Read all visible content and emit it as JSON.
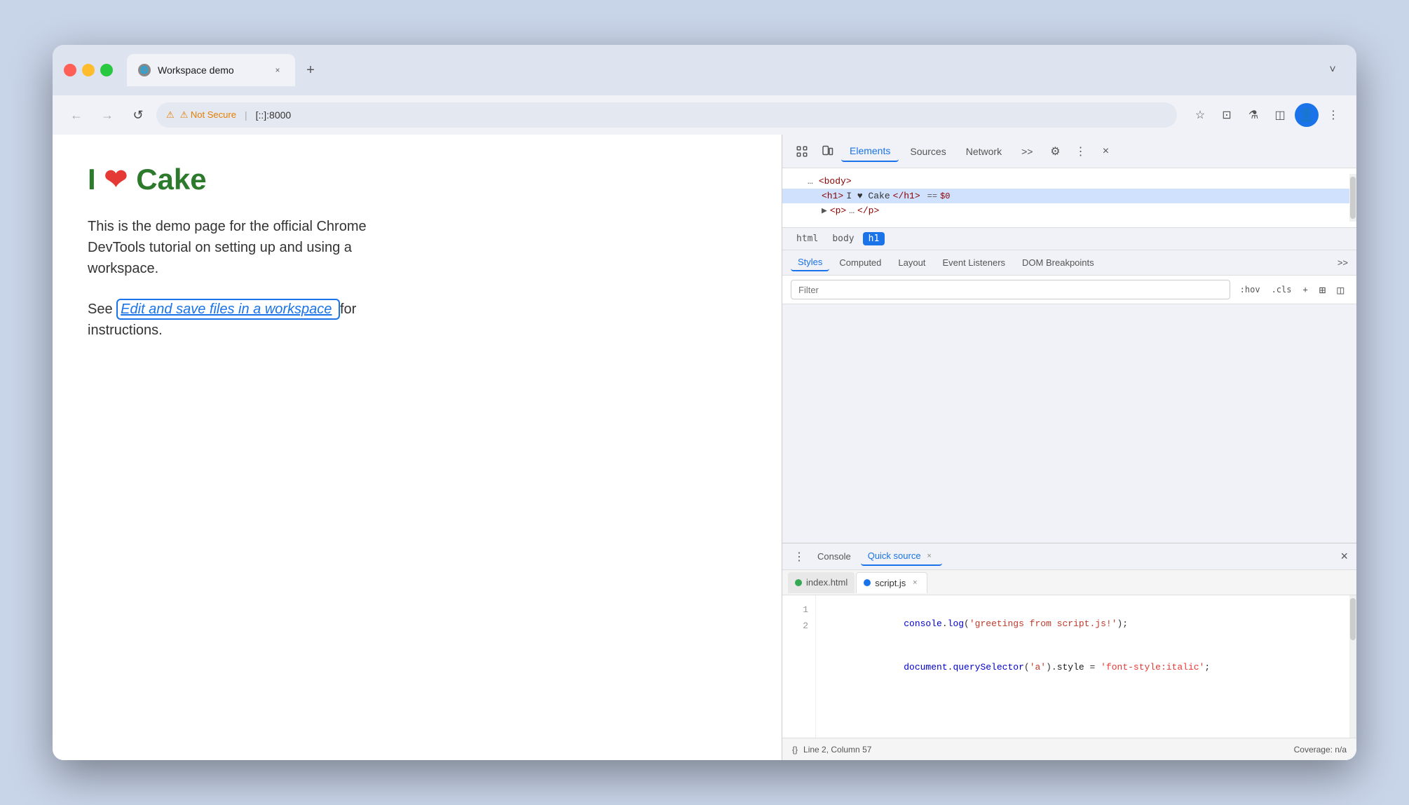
{
  "browser": {
    "tab_title": "Workspace demo",
    "tab_favicon": "🌐",
    "address_bar": {
      "security_label": "⚠ Not Secure",
      "url": "[::]:8000"
    },
    "nav": {
      "back_label": "←",
      "forward_label": "→",
      "reload_label": "↺"
    },
    "tab_close": "×",
    "tab_new": "+",
    "dropdown": "˅"
  },
  "webpage": {
    "heading": "Cake",
    "heading_i": "I",
    "body_text": "This is the demo page for the official Chrome DevTools tutorial on setting up and using a workspace.",
    "see_label": "See",
    "link_text": "Edit and save files in a workspace",
    "for_label": "for",
    "instructions": "instructions."
  },
  "devtools": {
    "inspect_icon": "⊡",
    "device_icon": "⬜",
    "tabs": [
      "Elements",
      "Sources",
      "Network",
      ">>"
    ],
    "active_tab": "Elements",
    "gear_label": "⚙",
    "dots_label": "⋮",
    "close_label": "×",
    "dom": {
      "row1": "<body>",
      "row2_open": "<h1>",
      "row2_text": "I ♥ Cake",
      "row2_close": "</h1>",
      "row2_eq": "==",
      "row2_dollar": "$0",
      "row3_arrow": "▶",
      "row3_tag": "<p>",
      "row3_dots": "…",
      "row3_close": "</p>"
    },
    "breadcrumbs": [
      "html",
      "body",
      "h1"
    ],
    "active_breadcrumb": "h1",
    "styles": {
      "tabs": [
        "Styles",
        "Computed",
        "Layout",
        "Event Listeners",
        "DOM Breakpoints",
        ">>"
      ],
      "active_tab": "Styles",
      "filter_placeholder": "Filter",
      "hov_label": ":hov",
      "cls_label": ".cls",
      "plus_label": "+",
      "force_icon": "⊞",
      "toggle_icon": "◫"
    }
  },
  "bottom_panel": {
    "tabs": [
      "Console",
      "Quick source"
    ],
    "active_tab": "Quick source",
    "tab_close": "×",
    "main_close": "×",
    "files": {
      "tab1_name": "index.html",
      "tab1_dot": "green",
      "tab2_name": "script.js",
      "tab2_dot": "blue",
      "tab2_close": "×"
    },
    "code": {
      "line1_num": "1",
      "line2_num": "2",
      "line1": "console.log('greetings from script.js!');",
      "line2": "document.querySelector('a').style = 'font-style:italic';"
    },
    "status": {
      "icon": "{}",
      "position": "Line 2, Column 57",
      "coverage": "Coverage: n/a"
    }
  }
}
